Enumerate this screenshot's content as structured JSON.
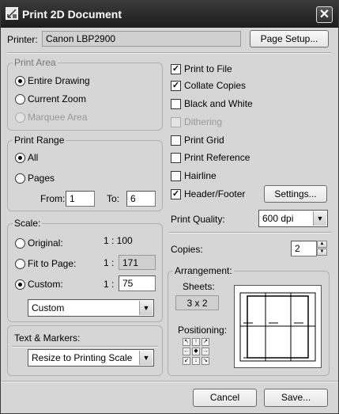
{
  "window": {
    "title": "Print 2D Document"
  },
  "printer": {
    "label": "Printer:",
    "value": "Canon LBP2900",
    "page_setup": "Page Setup..."
  },
  "print_area": {
    "legend": "Print Area",
    "entire_drawing": "Entire Drawing",
    "current_zoom": "Current Zoom",
    "marquee_area": "Marquee Area",
    "selected": "entire_drawing"
  },
  "print_range": {
    "legend": "Print Range",
    "all": "All",
    "pages": "Pages",
    "from_label": "From:",
    "from_value": "1",
    "to_label": "To:",
    "to_value": "6",
    "selected": "all"
  },
  "scale": {
    "legend": "Scale:",
    "original": "Original:",
    "original_value": "1 : 100",
    "fit_to_page": "Fit to Page:",
    "fit_prefix": "1 :",
    "fit_value": "171",
    "custom": "Custom:",
    "custom_prefix": "1 :",
    "custom_value": "75",
    "dropdown": "Custom",
    "selected": "custom"
  },
  "text_markers": {
    "legend": "Text & Markers:",
    "dropdown": "Resize to Printing Scale"
  },
  "options": {
    "print_to_file": {
      "label": "Print to File",
      "checked": true
    },
    "collate_copies": {
      "label": "Collate Copies",
      "checked": true
    },
    "black_and_white": {
      "label": "Black and White",
      "checked": false
    },
    "dithering": {
      "label": "Dithering",
      "checked": false,
      "disabled": true
    },
    "print_grid": {
      "label": "Print Grid",
      "checked": false
    },
    "print_reference": {
      "label": "Print Reference",
      "checked": false
    },
    "hairline": {
      "label": "Hairline",
      "checked": false
    },
    "header_footer": {
      "label": "Header/Footer",
      "checked": true
    },
    "settings": "Settings..."
  },
  "print_quality": {
    "label": "Print Quality:",
    "value": "600 dpi"
  },
  "copies": {
    "label": "Copies:",
    "value": "2"
  },
  "arrangement": {
    "legend": "Arrangement:",
    "sheets_label": "Sheets:",
    "sheets_value": "3 x 2",
    "positioning_label": "Positioning:"
  },
  "footer": {
    "cancel": "Cancel",
    "save": "Save..."
  }
}
